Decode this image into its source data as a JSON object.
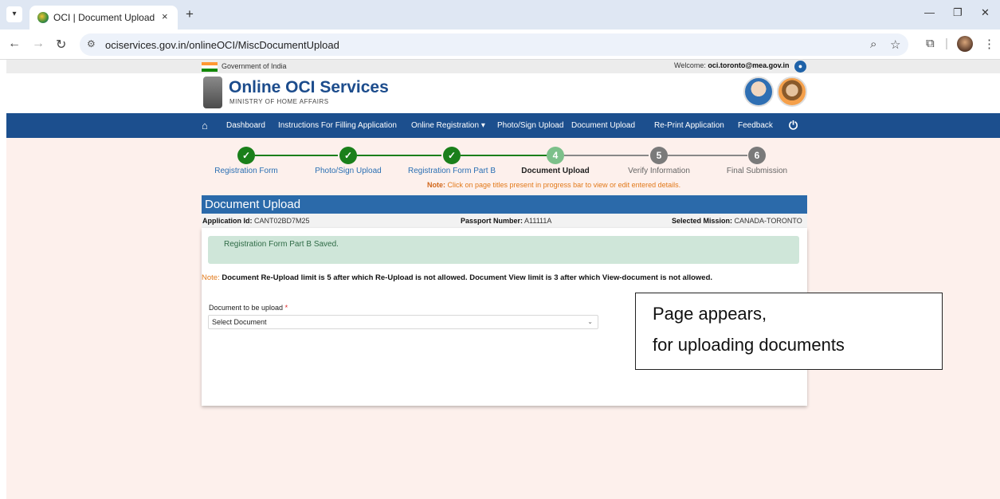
{
  "browser": {
    "tab_title": "OCI | Document Upload",
    "tab_close": "×",
    "new_tab": "+",
    "url": "ociservices.gov.in/onlineOCI/MiscDocumentUpload"
  },
  "gov_strip": {
    "government_text": "Government of India",
    "welcome_label": "Welcome:",
    "user_email": "oci.toronto@mea.gov.in"
  },
  "header": {
    "title": "Online OCI Services",
    "subtitle": "MINISTRY OF HOME AFFAIRS"
  },
  "nav": {
    "items": [
      "Dashboard",
      "Instructions For Filling Application",
      "Online Registration ▾",
      "Photo/Sign Upload",
      "Document Upload",
      "Re-Print Application",
      "Feedback"
    ]
  },
  "stepper": {
    "steps": [
      {
        "label": "Registration Form",
        "mark": "✓",
        "state": "done"
      },
      {
        "label": "Photo/Sign Upload",
        "mark": "✓",
        "state": "done"
      },
      {
        "label": "Registration Form Part B",
        "mark": "✓",
        "state": "done"
      },
      {
        "label": "Document Upload",
        "mark": "4",
        "state": "current"
      },
      {
        "label": "Verify Information",
        "mark": "5",
        "state": "todo"
      },
      {
        "label": "Final Submission",
        "mark": "6",
        "state": "todo"
      }
    ],
    "note_prefix": "Note:",
    "note_text": "Click on page titles present in progress bar to view or edit entered details."
  },
  "panel": {
    "title": "Document Upload",
    "application_id_label": "Application Id:",
    "application_id": "CANT02BD7M25",
    "passport_label": "Passport Number:",
    "passport": "A11111A",
    "mission_label": "Selected Mission:",
    "mission": "CANADA-TORONTO",
    "saved_message": "Registration Form Part B Saved.",
    "warning_prefix": "Note:",
    "warning_text": "Document Re-Upload limit is 5 after which Re-Upload is not allowed. Document View limit is 3 after which View-document is not allowed.",
    "field_label": "Document to be upload",
    "required_mark": "*",
    "select_value": "Select Document"
  },
  "callout": {
    "line1": "Page appears,",
    "line2": "for uploading documents"
  },
  "colors": {
    "nav_bg": "#1c4f8e",
    "panel_head": "#2b6aaa",
    "done_step": "#1a7f1a",
    "current_step": "#7cc08a",
    "todo_step": "#7a7a7a",
    "accent_orange": "#e2791a"
  }
}
